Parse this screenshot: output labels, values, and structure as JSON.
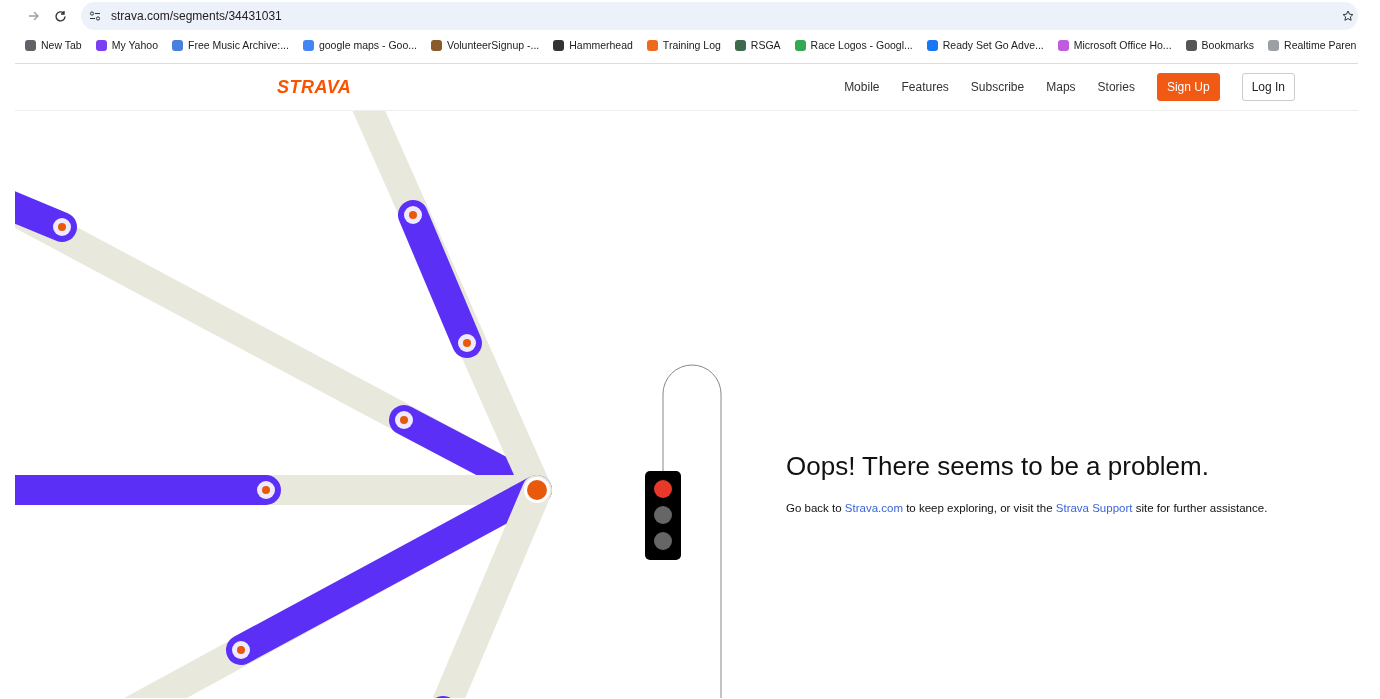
{
  "browser": {
    "url": "strava.com/segments/34431031",
    "bookmarks": [
      {
        "label": "New Tab",
        "color": "#5f6368"
      },
      {
        "label": "My Yahoo",
        "color": "#7b3ff2"
      },
      {
        "label": "Free Music Archive:...",
        "color": "#4a7fe0"
      },
      {
        "label": "google maps - Goo...",
        "color": "#4285f4"
      },
      {
        "label": "VolunteerSignup -...",
        "color": "#8a5a2b"
      },
      {
        "label": "Hammerhead",
        "color": "#333333"
      },
      {
        "label": "Training Log",
        "color": "#f06a1d"
      },
      {
        "label": "RSGA",
        "color": "#3b6b4a"
      },
      {
        "label": "Race Logos - Googl...",
        "color": "#34a853"
      },
      {
        "label": "Ready Set Go Adve...",
        "color": "#1877f2"
      },
      {
        "label": "Microsoft Office Ho...",
        "color": "#c05adf"
      },
      {
        "label": "Bookmarks",
        "color": "#555555"
      },
      {
        "label": "Realtime Paren",
        "color": "#9aa0a6"
      }
    ]
  },
  "header": {
    "logo": "STRAVA",
    "nav": [
      "Mobile",
      "Features",
      "Subscribe",
      "Maps",
      "Stories"
    ],
    "signup": "Sign Up",
    "login": "Log In"
  },
  "error": {
    "title": "Oops! There seems to be a problem.",
    "message": [
      {
        "kind": "text",
        "text": "Go back to "
      },
      {
        "kind": "link",
        "text": "Strava.com"
      },
      {
        "kind": "text",
        "text": " to keep exploring, or visit the "
      },
      {
        "kind": "link",
        "text": "Strava Support"
      },
      {
        "kind": "text",
        "text": " site for further assistance."
      }
    ]
  }
}
